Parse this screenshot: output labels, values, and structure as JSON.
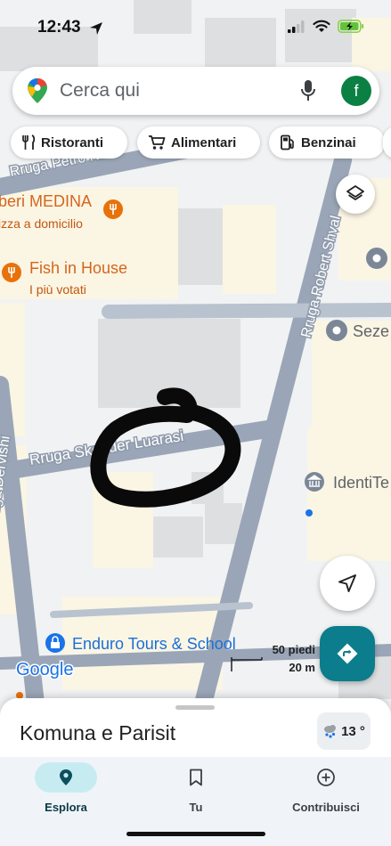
{
  "status_bar": {
    "time": "12:43"
  },
  "search": {
    "placeholder": "Cerca qui",
    "account_initial": "f"
  },
  "chips": [
    {
      "label": "Ristoranti",
      "icon": "utensils-icon"
    },
    {
      "label": "Alimentari",
      "icon": "cart-icon"
    },
    {
      "label": "Benzinai",
      "icon": "fuel-icon"
    }
  ],
  "map": {
    "streets": {
      "petro": "Rruga Petro Ko",
      "robert": "Rruga Robert Shval",
      "skender": "Rruga Skender Luarasi",
      "dervishi": "Rruga Dervishi"
    },
    "places": {
      "medina_name": "beri MEDINA",
      "medina_sub": "izza a domicilio",
      "fish_name": "Fish in House",
      "fish_sub": "I più votati",
      "seze": "Seze",
      "identi": "IdentiTe",
      "enduro": "Enduro Tours & School"
    },
    "google_logo": "Google",
    "scale_ft": "50 piedi",
    "scale_m": "20 m"
  },
  "sheet": {
    "title": "Komuna e Parisit",
    "temperature": "13 °"
  },
  "nav": {
    "explore": "Esplora",
    "you": "Tu",
    "contribute": "Contribuisci"
  },
  "colors": {
    "accent": "#0b7d8c",
    "food_pin": "#e8710a",
    "road": "#9aa7b8",
    "block": "#d9dadc"
  }
}
